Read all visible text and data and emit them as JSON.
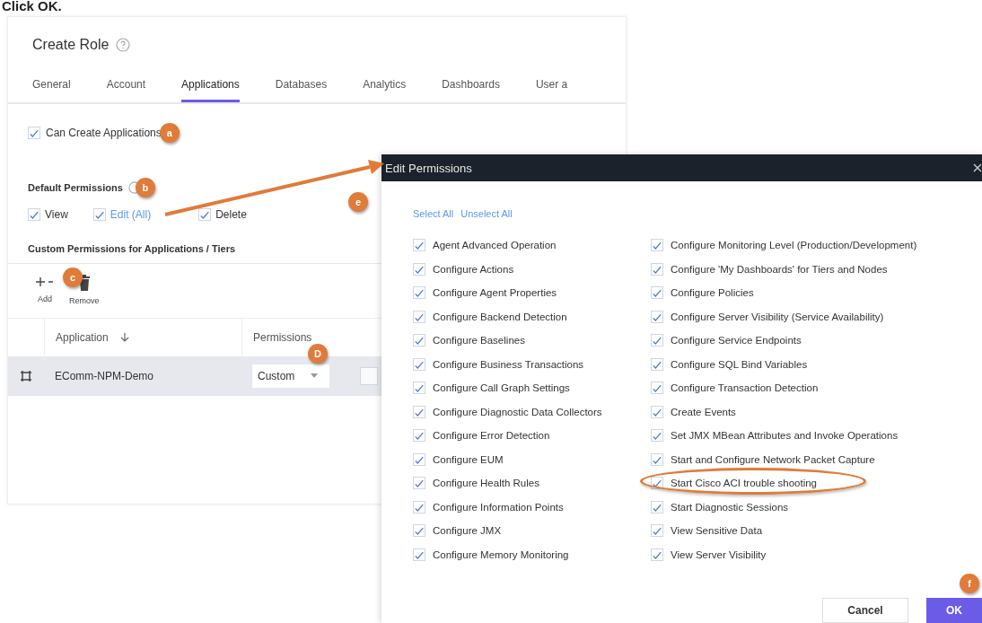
{
  "instruction": "Click OK.",
  "page": {
    "title": "Create Role",
    "tabs": [
      {
        "label": "General",
        "selected": false
      },
      {
        "label": "Account",
        "selected": false
      },
      {
        "label": "Applications",
        "selected": true
      },
      {
        "label": "Databases",
        "selected": false
      },
      {
        "label": "Analytics",
        "selected": false
      },
      {
        "label": "Dashboards",
        "selected": false
      },
      {
        "label": "User a",
        "selected": false
      }
    ],
    "can_create": {
      "label": "Can Create Applications",
      "checked": true,
      "callout": "a"
    },
    "default_permissions": {
      "heading": "Default Permissions",
      "callout": "b",
      "options": [
        {
          "label": "View",
          "checked": true,
          "kind": "plain"
        },
        {
          "label": "Edit (All)",
          "checked": true,
          "kind": "link"
        },
        {
          "label": "Delete",
          "checked": true,
          "kind": "plain"
        }
      ]
    },
    "custom_heading": "Custom Permissions for Applications / Tiers",
    "toolbar": {
      "callout": "c",
      "buttons": [
        {
          "label": "Add",
          "kind": "add"
        },
        {
          "label": "Remove",
          "kind": "remove"
        }
      ]
    },
    "table": {
      "columns": [
        "Application",
        "Permissions"
      ],
      "rows": [
        {
          "application": "EComm-NPM-Demo",
          "permissions": "Custom",
          "selected": true,
          "checked": false,
          "callout": "D"
        }
      ]
    }
  },
  "dialog": {
    "title": "Edit Permissions",
    "callout": "e",
    "links": [
      "Select All",
      "Unselect All"
    ],
    "columns": [
      [
        {
          "label": "Agent Advanced Operation",
          "checked": true,
          "highlighted": false
        },
        {
          "label": "Configure Actions",
          "checked": true,
          "highlighted": false
        },
        {
          "label": "Configure Agent Properties",
          "checked": true,
          "highlighted": false
        },
        {
          "label": "Configure Backend Detection",
          "checked": true,
          "highlighted": false
        },
        {
          "label": "Configure Baselines",
          "checked": true,
          "highlighted": false
        },
        {
          "label": "Configure Business Transactions",
          "checked": true,
          "highlighted": false
        },
        {
          "label": "Configure Call Graph Settings",
          "checked": true,
          "highlighted": false
        },
        {
          "label": "Configure Diagnostic Data Collectors",
          "checked": true,
          "highlighted": false
        },
        {
          "label": "Configure Error Detection",
          "checked": true,
          "highlighted": false
        },
        {
          "label": "Configure EUM",
          "checked": true,
          "highlighted": false
        },
        {
          "label": "Configure Health Rules",
          "checked": true,
          "highlighted": false
        },
        {
          "label": "Configure Information Points",
          "checked": true,
          "highlighted": false
        },
        {
          "label": "Configure JMX",
          "checked": true,
          "highlighted": false
        },
        {
          "label": "Configure Memory Monitoring",
          "checked": true,
          "highlighted": false
        }
      ],
      [
        {
          "label": "Configure Monitoring Level (Production/Development)",
          "checked": true,
          "highlighted": false
        },
        {
          "label": "Configure 'My Dashboards' for Tiers and Nodes",
          "checked": true,
          "highlighted": false
        },
        {
          "label": "Configure Policies",
          "checked": true,
          "highlighted": false
        },
        {
          "label": "Configure Server Visibility (Service Availability)",
          "checked": true,
          "highlighted": false
        },
        {
          "label": "Configure Service Endpoints",
          "checked": true,
          "highlighted": false
        },
        {
          "label": "Configure SQL Bind Variables",
          "checked": true,
          "highlighted": false
        },
        {
          "label": "Configure Transaction Detection",
          "checked": true,
          "highlighted": false
        },
        {
          "label": "Create Events",
          "checked": true,
          "highlighted": false
        },
        {
          "label": "Set JMX MBean Attributes and Invoke Operations",
          "checked": true,
          "highlighted": false
        },
        {
          "label": "Start and Configure Network Packet Capture",
          "checked": true,
          "highlighted": false
        },
        {
          "label": "Start Cisco ACI trouble shooting",
          "checked": true,
          "highlighted": true
        },
        {
          "label": "Start Diagnostic Sessions",
          "checked": true,
          "highlighted": false
        },
        {
          "label": "View Sensitive Data",
          "checked": true,
          "highlighted": false
        },
        {
          "label": "View Server Visibility",
          "checked": true,
          "highlighted": false
        }
      ]
    ],
    "buttons": [
      {
        "label": "Cancel",
        "kind": "secondary"
      },
      {
        "label": "OK",
        "kind": "primary",
        "callout": "f"
      }
    ]
  }
}
